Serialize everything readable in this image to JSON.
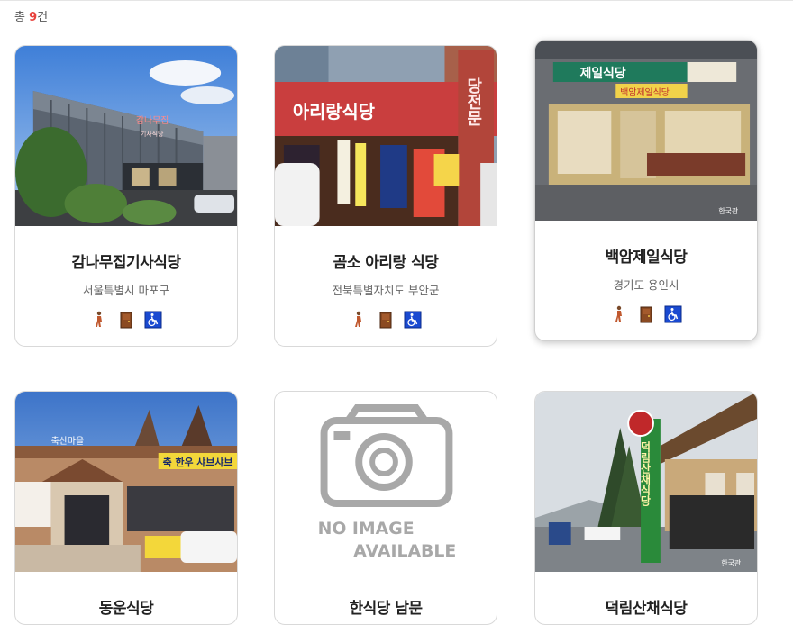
{
  "summary": {
    "prefix": "총",
    "count": "9",
    "suffix": "건"
  },
  "cards": [
    {
      "title": "감나무집기사식당",
      "region": "서울특별시 마포구",
      "photo": "photo",
      "sign": "감나무집",
      "subsign": "기사식당"
    },
    {
      "title": "곰소 아리랑 식당",
      "region": "전북특별자치도 부안군",
      "photo": "photo",
      "sign": "아리랑식당",
      "subsign": "당전문"
    },
    {
      "title": "백암제일식당",
      "region": "경기도 용인시",
      "photo": "photo",
      "sign": "제일식당",
      "subsign": "백암제일식당"
    },
    {
      "title": "동운식당",
      "region": "",
      "photo": "photo",
      "sign": "",
      "subsign": "축 한우 샤브샤브"
    },
    {
      "title": "한식당 남문",
      "region": "",
      "photo": "no-image",
      "noimage_line1": "NO IMAGE",
      "noimage_line2": "AVAILABLE"
    },
    {
      "title": "덕림산채식당",
      "region": "",
      "photo": "photo",
      "sign": "덕림산채식당",
      "subsign": ""
    }
  ],
  "amenity_icons": [
    "walking-person-icon",
    "door-icon",
    "wheelchair-icon"
  ],
  "colors": {
    "accent": "#e8413c",
    "wheelchair_bg": "#1a4ad1"
  }
}
